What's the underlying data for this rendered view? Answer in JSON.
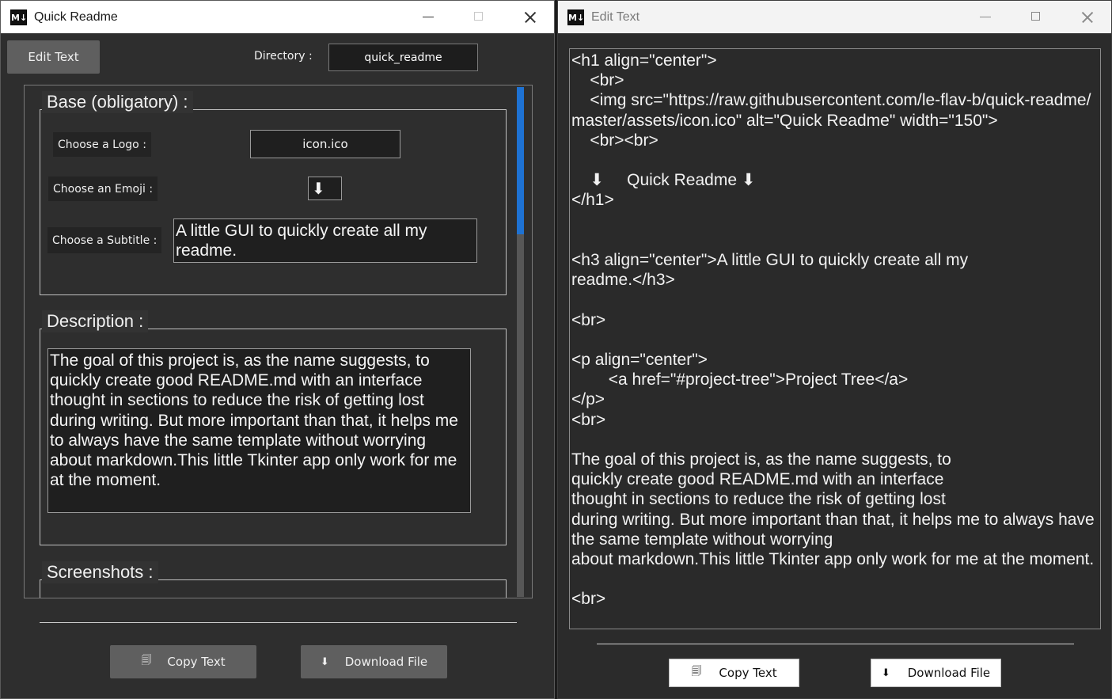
{
  "left_window": {
    "app_icon": "M↓",
    "title": "Quick Readme",
    "edit_text_label": "Edit Text",
    "directory_label": "Directory :",
    "directory_value": "quick_readme",
    "base_group": {
      "title": "Base (obligatory) :",
      "logo_label": "Choose a Logo :",
      "logo_value": "icon.ico",
      "emoji_label": "Choose an Emoji :",
      "emoji_value": "⬇",
      "subtitle_label": "Choose a Subtitle :",
      "subtitle_value": "A little GUI to quickly create all my readme."
    },
    "description_group": {
      "title": "Description :",
      "text": "The goal of this project is, as the name suggests, to quickly create good README.md with an interface thought in sections to reduce the risk of getting lost during writing. But more important than that, it helps me to always have the same template without worrying about markdown.This little Tkinter app only work for me at the moment."
    },
    "screenshots_group": {
      "title": "Screenshots :"
    },
    "copy_label": "Copy Text",
    "download_label": "Download File"
  },
  "right_window": {
    "app_icon": "M↓",
    "title": "Edit Text",
    "code": "<h1 align=\"center\">\n    <br>\n    <img src=\"https://raw.githubusercontent.com/le-flav-b/quick-readme/master/assets/icon.ico\" alt=\"Quick Readme\" width=\"150\">\n    <br><br>\n\n    ⬇     Quick Readme ⬇\n</h1>\n\n\n<h3 align=\"center\">A little GUI to quickly create all my\nreadme.</h3>\n\n<br>\n\n<p align=\"center\">\n        <a href=\"#project-tree\">Project Tree</a>\n</p>\n<br>\n\nThe goal of this project is, as the name suggests, to\nquickly create good README.md with an interface\nthought in sections to reduce the risk of getting lost\nduring writing. But more important than that, it helps me to always have the same template without worrying\nabout markdown.This little Tkinter app only work for me at the moment.\n\n<br>",
    "copy_label": "Copy Text",
    "download_label": "Download File"
  },
  "icons": {
    "copy": "🗐",
    "download": "⬇"
  }
}
